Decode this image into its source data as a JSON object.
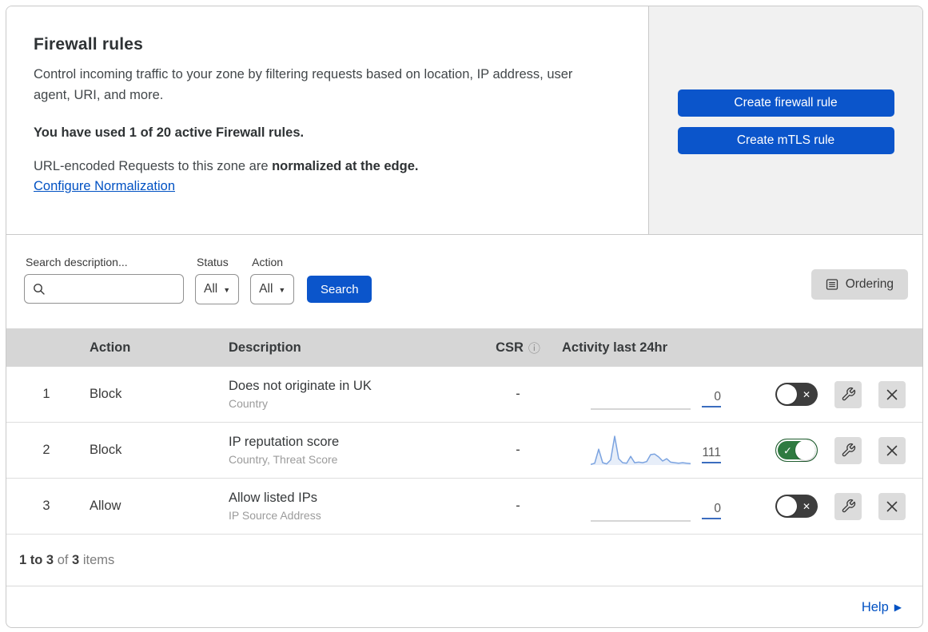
{
  "colors": {
    "primary_blue": "#0b55cb",
    "link_blue": "#0051c3",
    "toggle_on_green": "#2e7b40",
    "toggle_off_gray": "#3d3d3d",
    "spark_blue": "#7ba3e0",
    "table_header_gray": "#d6d6d6",
    "panel_gray": "#f1f1f1"
  },
  "header": {
    "title": "Firewall rules",
    "description": "Control incoming traffic to your zone by filtering requests based on location, IP address, user agent, URI, and more.",
    "usage": "You have used 1 of 20 active Firewall rules.",
    "norm_prefix": "URL-encoded Requests to this zone are ",
    "norm_bold": "normalized at the edge.",
    "norm_link": "Configure Normalization",
    "buttons": [
      "Create firewall rule",
      "Create mTLS rule"
    ]
  },
  "filters": {
    "search_label": "Search description...",
    "status_label": "Status",
    "status_value": "All",
    "action_label": "Action",
    "action_value": "All",
    "search_button": "Search",
    "ordering_button": "Ordering"
  },
  "table": {
    "columns": [
      "Action",
      "Description",
      "CSR",
      "Activity last 24hr"
    ],
    "rows": [
      {
        "index": "1",
        "action": "Block",
        "description": "Does not originate in UK",
        "fields": "Country",
        "csr": "-",
        "activity_count": "0",
        "enabled": false,
        "sparkline": []
      },
      {
        "index": "2",
        "action": "Block",
        "description": "IP reputation score",
        "fields": "Country, Threat Score",
        "csr": "-",
        "activity_count": "111",
        "enabled": true,
        "sparkline": [
          2,
          6,
          55,
          8,
          4,
          18,
          100,
          22,
          8,
          6,
          30,
          8,
          10,
          8,
          12,
          36,
          38,
          28,
          14,
          22,
          10,
          8,
          6,
          8,
          6,
          5
        ]
      },
      {
        "index": "3",
        "action": "Allow",
        "description": "Allow listed IPs",
        "fields": "IP Source Address",
        "csr": "-",
        "activity_count": "0",
        "enabled": false,
        "sparkline": []
      }
    ]
  },
  "pagination": {
    "range": "1 to 3",
    "of": " of ",
    "total": "3",
    "items": " items"
  },
  "help": {
    "label": "Help"
  }
}
